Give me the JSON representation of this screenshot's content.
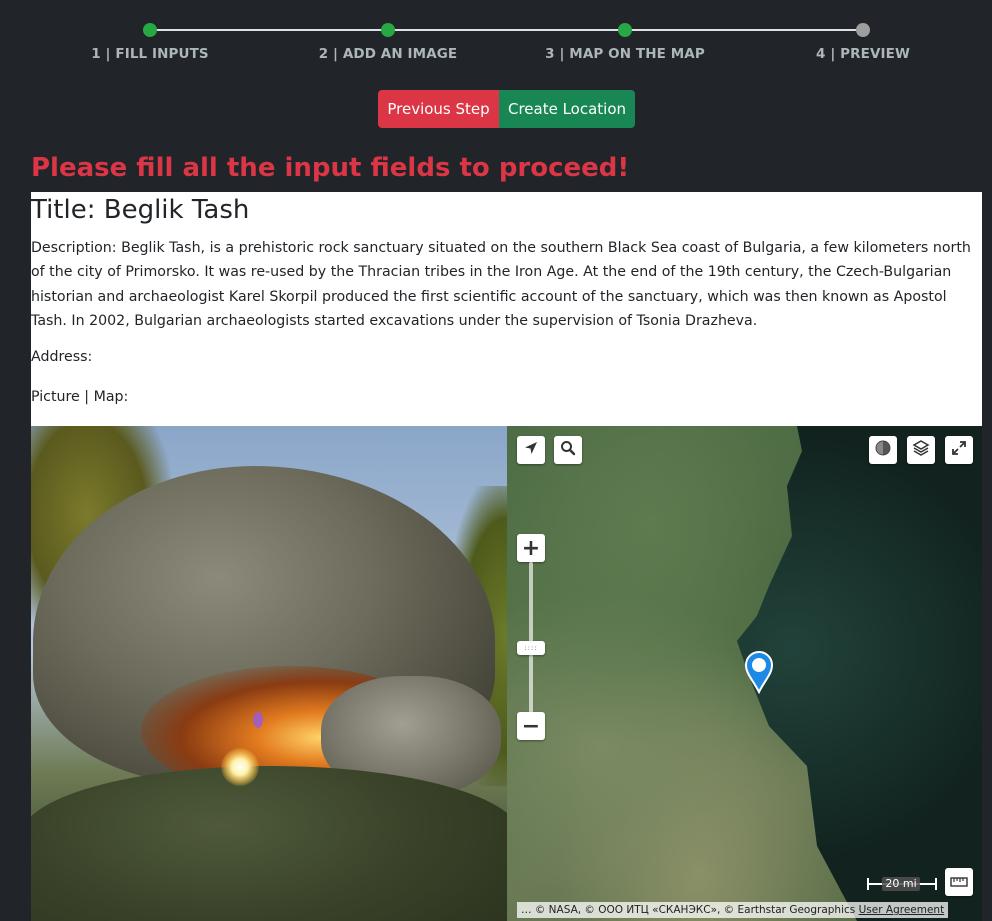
{
  "stepper": {
    "steps": [
      {
        "label": "1 | FILL INPUTS",
        "status": "complete"
      },
      {
        "label": "2 | ADD AN IMAGE",
        "status": "complete"
      },
      {
        "label": "3 | MAP ON THE MAP",
        "status": "complete"
      },
      {
        "label": "4 | PREVIEW",
        "status": "current"
      }
    ],
    "colors": {
      "complete": "#28a745",
      "pending": "#9e9e9e",
      "line": "#dee2e6"
    }
  },
  "actions": {
    "previous_label": "Previous Step",
    "create_label": "Create Location"
  },
  "alert": {
    "message": "Please fill all the input fields to proceed!"
  },
  "preview": {
    "title": "Title: Beglik Tash",
    "description": "Description: Beglik Tash, is a prehistoric rock sanctuary situated on the southern Black Sea coast of Bulgaria, a few kilometers north of the city of Primorsko. It was re-used by the Thracian tribes in the Iron Age. At the end of the 19th century, the Czech-Bulgarian historian and archaeologist Karel Skorpil produced the first scientific account of the sanctuary, which was then known as Apostol Tash. In 2002, Bulgarian archaeologists started excavations under the supervision of Tsonia Drazheva.",
    "address": "Address:",
    "picture_map_label": "Picture | Map:"
  },
  "map": {
    "controls": {
      "locate_icon": "navigation-arrow-icon",
      "search_icon": "search-icon",
      "basemap_icon": "basemap-toggle-icon",
      "layers_icon": "layers-icon",
      "fullscreen_icon": "fullscreen-icon",
      "zoom_in": "+",
      "zoom_out": "−",
      "measure_icon": "ruler-icon"
    },
    "scale_label": "20 mi",
    "attribution": "… © NASA, © ООО ИТЦ «СКАНЭКС», © Earthstar Geographics",
    "attribution_link": "User Agreement",
    "marker_color": "#1e88e5"
  }
}
